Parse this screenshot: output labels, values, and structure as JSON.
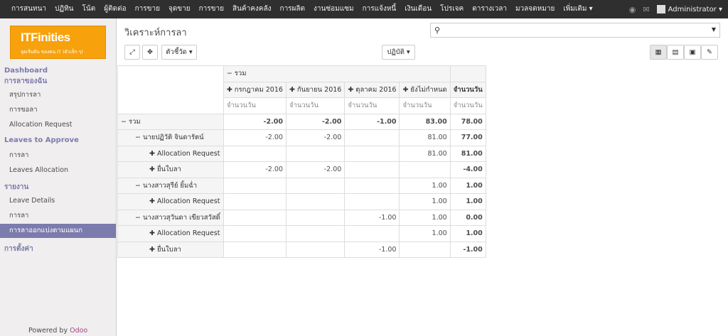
{
  "topmenu": [
    "การสนทนา",
    "ปฏิทิน",
    "โน้ต",
    "ผู้ติดต่อ",
    "การขาย",
    "จุดขาย",
    "การขาย",
    "สินค้าคงคลัง",
    "การผลิต",
    "งานซ่อมแซม",
    "การแจ้งหนี้",
    "เงินเดือน",
    "โปรเจค",
    "ตารางเวลา",
    "มวลจดหมาย",
    "เพิ่มเติม ▾"
  ],
  "user": {
    "name": "Administrator ▾"
  },
  "logo": {
    "title": "ITFinities",
    "subtitle": "จุดเริ่มต้น ของคน IT (ตัวเล็ก ๆ)"
  },
  "sidebar": {
    "sec_dashboard": "Dashboard",
    "sec_my_leaves": "การลาของฉัน",
    "summary": "สรุปการลา",
    "requests": "การขอลา",
    "alloc_req": "Allocation Request",
    "sec_approve": "Leaves to Approve",
    "leave": "การลา",
    "leaves_alloc": "Leaves Allocation",
    "sec_report": "รายงาน",
    "leave_details": "Leave Details",
    "leave2": "การลา",
    "by_dept": "การลาออกแบ่งตามแผนก",
    "sec_settings": "การตั้งค่า"
  },
  "powered": {
    "prefix": "Powered by ",
    "brand": "Odoo"
  },
  "main": {
    "title": "วิเคราะห์การลา",
    "measures_btn": "ตัวชี้วัด ▾",
    "action_btn": "ปฏิบัติ ▾"
  },
  "pivot": {
    "total_col": "− รวม",
    "cols": [
      "✚ กรกฎาคม 2016",
      "✚ กันยายน 2016",
      "✚ ตุลาคม 2016",
      "✚ ยังไม่กำหนด"
    ],
    "total_header": "จำนวนวัน",
    "measure": "จำนวนวัน",
    "rows": [
      {
        "label": "− รวม",
        "indent": 0,
        "vals": [
          "-2.00",
          "-2.00",
          "-1.00",
          "83.00",
          "78.00"
        ],
        "bold": true
      },
      {
        "label": "− นายปฏิวัติ จินดารัตน์",
        "indent": 1,
        "vals": [
          "-2.00",
          "-2.00",
          "",
          "81.00",
          "77.00"
        ]
      },
      {
        "label": "✚ Allocation Request",
        "indent": 2,
        "vals": [
          "",
          "",
          "",
          "81.00",
          "81.00"
        ]
      },
      {
        "label": "✚ ยื่นใบลา",
        "indent": 2,
        "vals": [
          "-2.00",
          "-2.00",
          "",
          "",
          "-4.00"
        ]
      },
      {
        "label": "− นางสาวสุรีย์ ยิ้มฉ่ำ",
        "indent": 1,
        "vals": [
          "",
          "",
          "",
          "1.00",
          "1.00"
        ]
      },
      {
        "label": "✚ Allocation Request",
        "indent": 2,
        "vals": [
          "",
          "",
          "",
          "1.00",
          "1.00"
        ]
      },
      {
        "label": "− นางสาวสุวันดา เขียวสวัสดิ์",
        "indent": 1,
        "vals": [
          "",
          "",
          "-1.00",
          "1.00",
          "0.00"
        ]
      },
      {
        "label": "✚ Allocation Request",
        "indent": 2,
        "vals": [
          "",
          "",
          "",
          "1.00",
          "1.00"
        ]
      },
      {
        "label": "✚ ยื่นใบลา",
        "indent": 2,
        "vals": [
          "",
          "",
          "-1.00",
          "",
          "-1.00"
        ]
      }
    ]
  }
}
